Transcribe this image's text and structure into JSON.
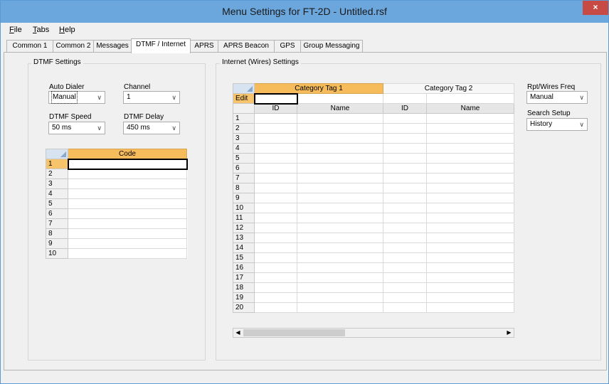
{
  "window": {
    "title": "Menu Settings for FT-2D - Untitled.rsf",
    "close_label": "×"
  },
  "menu": {
    "file": {
      "key": "F",
      "rest": "ile"
    },
    "tabs": {
      "key": "T",
      "rest": "abs"
    },
    "help": {
      "key": "H",
      "rest": "elp"
    }
  },
  "tabs": [
    "Common 1",
    "Common 2",
    "Messages",
    "DTMF / Internet",
    "APRS",
    "APRS Beacon",
    "GPS",
    "Group Messaging"
  ],
  "active_tab": "DTMF / Internet",
  "dtmf": {
    "group_title": "DTMF Settings",
    "auto_dialer": {
      "label": "Auto Dialer",
      "value": "Manual"
    },
    "channel": {
      "label": "Channel",
      "value": "1"
    },
    "speed": {
      "label": "DTMF Speed",
      "value": "50 ms"
    },
    "delay": {
      "label": "DTMF Delay",
      "value": "450 ms"
    },
    "grid": {
      "header": "Code",
      "rows": [
        "1",
        "2",
        "3",
        "4",
        "5",
        "6",
        "7",
        "8",
        "9",
        "10"
      ]
    }
  },
  "internet": {
    "group_title": "Internet (Wires) Settings",
    "category_tag_1": "Category Tag 1",
    "category_tag_2": "Category Tag 2",
    "edit_label": "Edit",
    "col_id": "ID",
    "col_name": "Name",
    "rows": [
      "1",
      "2",
      "3",
      "4",
      "5",
      "6",
      "7",
      "8",
      "9",
      "10",
      "11",
      "12",
      "13",
      "14",
      "15",
      "16",
      "17",
      "18",
      "19",
      "20"
    ]
  },
  "right_panel": {
    "rpt_label": "Rpt/Wires Freq",
    "rpt_value": "Manual",
    "search_label": "Search Setup",
    "search_value": "History"
  },
  "colors": {
    "titlebar": "#6ba7dd",
    "close": "#c74a45",
    "selected_header": "#f6bc5c"
  },
  "icons": {
    "dropdown": "chevron-down-icon",
    "scroll_left": "triangle-left-icon",
    "scroll_right": "triangle-right-icon"
  }
}
